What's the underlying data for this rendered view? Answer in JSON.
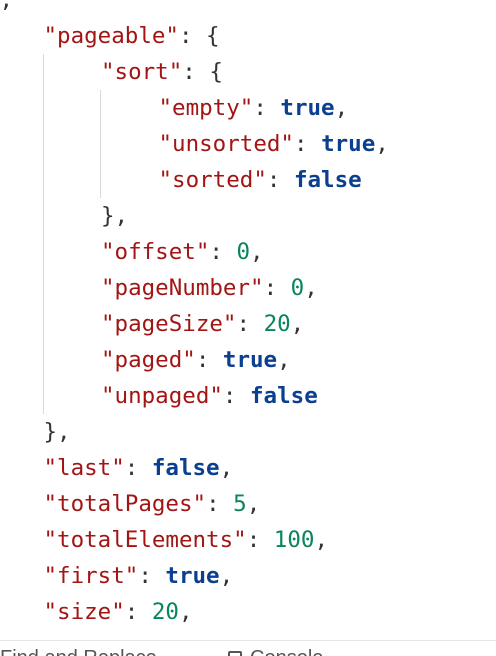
{
  "json_view": {
    "lines": [
      {
        "indent": 0,
        "parts": [
          {
            "t": "punc",
            "v": "],"
          }
        ]
      },
      {
        "indent": 1,
        "parts": [
          {
            "t": "key",
            "v": "\"pageable\""
          },
          {
            "t": "punc",
            "v": ": {"
          }
        ]
      },
      {
        "indent": 2,
        "parts": [
          {
            "t": "key",
            "v": "\"sort\""
          },
          {
            "t": "punc",
            "v": ": {"
          }
        ]
      },
      {
        "indent": 3,
        "parts": [
          {
            "t": "key",
            "v": "\"empty\""
          },
          {
            "t": "punc",
            "v": ": "
          },
          {
            "t": "bool",
            "v": "true"
          },
          {
            "t": "punc",
            "v": ","
          }
        ]
      },
      {
        "indent": 3,
        "parts": [
          {
            "t": "key",
            "v": "\"unsorted\""
          },
          {
            "t": "punc",
            "v": ": "
          },
          {
            "t": "bool",
            "v": "true"
          },
          {
            "t": "punc",
            "v": ","
          }
        ]
      },
      {
        "indent": 3,
        "parts": [
          {
            "t": "key",
            "v": "\"sorted\""
          },
          {
            "t": "punc",
            "v": ": "
          },
          {
            "t": "bool",
            "v": "false"
          }
        ]
      },
      {
        "indent": 2,
        "parts": [
          {
            "t": "punc",
            "v": "},"
          }
        ]
      },
      {
        "indent": 2,
        "parts": [
          {
            "t": "key",
            "v": "\"offset\""
          },
          {
            "t": "punc",
            "v": ": "
          },
          {
            "t": "num",
            "v": "0"
          },
          {
            "t": "punc",
            "v": ","
          }
        ]
      },
      {
        "indent": 2,
        "parts": [
          {
            "t": "key",
            "v": "\"pageNumber\""
          },
          {
            "t": "punc",
            "v": ": "
          },
          {
            "t": "num",
            "v": "0"
          },
          {
            "t": "punc",
            "v": ","
          }
        ]
      },
      {
        "indent": 2,
        "parts": [
          {
            "t": "key",
            "v": "\"pageSize\""
          },
          {
            "t": "punc",
            "v": ": "
          },
          {
            "t": "num",
            "v": "20"
          },
          {
            "t": "punc",
            "v": ","
          }
        ]
      },
      {
        "indent": 2,
        "parts": [
          {
            "t": "key",
            "v": "\"paged\""
          },
          {
            "t": "punc",
            "v": ": "
          },
          {
            "t": "bool",
            "v": "true"
          },
          {
            "t": "punc",
            "v": ","
          }
        ]
      },
      {
        "indent": 2,
        "parts": [
          {
            "t": "key",
            "v": "\"unpaged\""
          },
          {
            "t": "punc",
            "v": ": "
          },
          {
            "t": "bool",
            "v": "false"
          }
        ]
      },
      {
        "indent": 1,
        "parts": [
          {
            "t": "punc",
            "v": "},"
          }
        ]
      },
      {
        "indent": 1,
        "parts": [
          {
            "t": "key",
            "v": "\"last\""
          },
          {
            "t": "punc",
            "v": ": "
          },
          {
            "t": "bool",
            "v": "false"
          },
          {
            "t": "punc",
            "v": ","
          }
        ]
      },
      {
        "indent": 1,
        "parts": [
          {
            "t": "key",
            "v": "\"totalPages\""
          },
          {
            "t": "punc",
            "v": ": "
          },
          {
            "t": "num",
            "v": "5"
          },
          {
            "t": "punc",
            "v": ","
          }
        ]
      },
      {
        "indent": 1,
        "parts": [
          {
            "t": "key",
            "v": "\"totalElements\""
          },
          {
            "t": "punc",
            "v": ": "
          },
          {
            "t": "num",
            "v": "100"
          },
          {
            "t": "punc",
            "v": ","
          }
        ]
      },
      {
        "indent": 1,
        "parts": [
          {
            "t": "key",
            "v": "\"first\""
          },
          {
            "t": "punc",
            "v": ": "
          },
          {
            "t": "bool",
            "v": "true"
          },
          {
            "t": "punc",
            "v": ","
          }
        ]
      },
      {
        "indent": 1,
        "parts": [
          {
            "t": "key",
            "v": "\"size\""
          },
          {
            "t": "punc",
            "v": ": "
          },
          {
            "t": "num",
            "v": "20"
          },
          {
            "t": "punc",
            "v": ","
          }
        ]
      }
    ]
  },
  "footer": {
    "left_label": "Find and Replace",
    "right_label": "Console",
    "right_icon": "checkbox-icon"
  },
  "colors": {
    "key": "#a31515",
    "bool": "#0b3f8f",
    "number": "#098658",
    "punctuation": "#333333"
  }
}
